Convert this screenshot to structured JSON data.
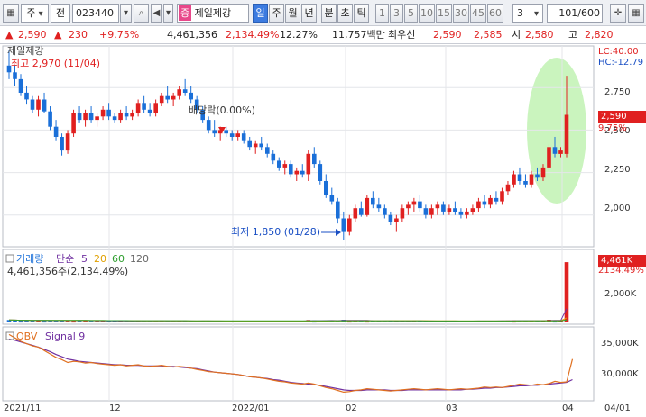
{
  "toolbar": {
    "market_select": "주",
    "type_select": "전",
    "code": "023440",
    "stock_tag": "증",
    "stock_name": "제일제강",
    "periods": [
      "일",
      "주",
      "월",
      "년",
      "분",
      "초",
      "틱"
    ],
    "active_period": "일",
    "intervals": [
      "1",
      "3",
      "5",
      "10",
      "15",
      "30",
      "45",
      "60"
    ],
    "interval_select": "3",
    "page_counter": "101",
    "page_total": "/600"
  },
  "infobar": {
    "price": "2,590",
    "change": "230",
    "change_pct": "+9.75%",
    "volume": "4,461,356",
    "volume_ratio": "2,134.49%",
    "turnover": "12.27%",
    "amount": "11,757백만",
    "best_offer_label": "최우선",
    "best_ask": "2,590",
    "best_bid": "2,585",
    "open_label": "시",
    "open": "2,580",
    "high_label": "고",
    "high": "2,820"
  },
  "price_panel": {
    "title": "제일제강",
    "high_note": "최고 2,970 (11/04)",
    "low_note": "최저 1,850 (01/28)",
    "dividend_note": "배당락(0.00%)",
    "lc_label": "LC:40.00",
    "hc_label": "HC:-12.79",
    "axis": [
      "2,750",
      "2,500",
      "2,250",
      "2,000"
    ],
    "current_price": "2,590",
    "current_change": "9.75%"
  },
  "volume_panel": {
    "legend_title": "거래량",
    "ma_label": "단순",
    "ma_periods": [
      "5",
      "20",
      "60",
      "120"
    ],
    "summary": "4,461,356주(2,134.49%)",
    "axis": [
      "2,000K"
    ],
    "current_volume": "4,461K",
    "current_ratio": "2134.49%"
  },
  "obv_panel": {
    "legend_obv": "OBV",
    "legend_signal": "Signal 9",
    "axis": [
      "35,000K",
      "30,000K"
    ]
  },
  "x_axis": {
    "labels": [
      "2021/11",
      "12",
      "2022/01",
      "02",
      "03",
      "04",
      "04/01"
    ]
  },
  "colors": {
    "up": "#e02020",
    "down": "#1a6fd8",
    "ma5": "#e0a000",
    "ma20": "#2e9e2e",
    "ma60": "#1a4fc4",
    "obv": "#e07020",
    "signal": "#7030a0",
    "highlight": "#b8f0a8"
  },
  "chart_data": {
    "type": "candlestick",
    "price_ylim": [
      1850,
      2900
    ],
    "candles": [
      [
        2880,
        2970,
        2800,
        2840
      ],
      [
        2840,
        2880,
        2760,
        2800
      ],
      [
        2800,
        2830,
        2700,
        2720
      ],
      [
        2720,
        2760,
        2650,
        2680
      ],
      [
        2680,
        2700,
        2600,
        2620
      ],
      [
        2620,
        2700,
        2580,
        2680
      ],
      [
        2680,
        2720,
        2600,
        2610
      ],
      [
        2610,
        2640,
        2500,
        2520
      ],
      [
        2520,
        2560,
        2440,
        2460
      ],
      [
        2460,
        2480,
        2350,
        2380
      ],
      [
        2380,
        2500,
        2360,
        2480
      ],
      [
        2480,
        2620,
        2460,
        2600
      ],
      [
        2600,
        2640,
        2540,
        2560
      ],
      [
        2560,
        2620,
        2520,
        2600
      ],
      [
        2600,
        2640,
        2540,
        2560
      ],
      [
        2560,
        2600,
        2520,
        2580
      ],
      [
        2580,
        2640,
        2560,
        2620
      ],
      [
        2620,
        2660,
        2560,
        2580
      ],
      [
        2580,
        2600,
        2540,
        2560
      ],
      [
        2560,
        2620,
        2540,
        2600
      ],
      [
        2600,
        2640,
        2560,
        2580
      ],
      [
        2580,
        2620,
        2560,
        2600
      ],
      [
        2600,
        2680,
        2580,
        2660
      ],
      [
        2660,
        2700,
        2600,
        2620
      ],
      [
        2620,
        2660,
        2580,
        2600
      ],
      [
        2600,
        2680,
        2580,
        2660
      ],
      [
        2660,
        2720,
        2640,
        2700
      ],
      [
        2700,
        2760,
        2660,
        2680
      ],
      [
        2680,
        2720,
        2640,
        2700
      ],
      [
        2700,
        2760,
        2680,
        2740
      ],
      [
        2740,
        2800,
        2700,
        2720
      ],
      [
        2720,
        2760,
        2660,
        2680
      ],
      [
        2680,
        2700,
        2600,
        2620
      ],
      [
        2620,
        2640,
        2540,
        2560
      ],
      [
        2560,
        2580,
        2480,
        2500
      ],
      [
        2500,
        2560,
        2460,
        2480
      ],
      [
        2480,
        2520,
        2440,
        2500
      ],
      [
        2500,
        2520,
        2460,
        2480
      ],
      [
        2480,
        2500,
        2440,
        2460
      ],
      [
        2460,
        2500,
        2440,
        2480
      ],
      [
        2480,
        2500,
        2420,
        2440
      ],
      [
        2440,
        2460,
        2380,
        2400
      ],
      [
        2400,
        2440,
        2360,
        2420
      ],
      [
        2420,
        2460,
        2380,
        2400
      ],
      [
        2400,
        2420,
        2340,
        2360
      ],
      [
        2360,
        2380,
        2300,
        2320
      ],
      [
        2320,
        2340,
        2260,
        2280
      ],
      [
        2280,
        2320,
        2240,
        2300
      ],
      [
        2300,
        2320,
        2220,
        2240
      ],
      [
        2240,
        2280,
        2200,
        2260
      ],
      [
        2260,
        2300,
        2220,
        2240
      ],
      [
        2240,
        2380,
        2200,
        2360
      ],
      [
        2360,
        2400,
        2280,
        2300
      ],
      [
        2300,
        2320,
        2180,
        2200
      ],
      [
        2200,
        2240,
        2100,
        2120
      ],
      [
        2120,
        2160,
        2060,
        2080
      ],
      [
        2080,
        2100,
        1950,
        1980
      ],
      [
        1980,
        2020,
        1850,
        1900
      ],
      [
        1900,
        2000,
        1880,
        1980
      ],
      [
        1980,
        2060,
        1960,
        2040
      ],
      [
        2040,
        2080,
        1990,
        2000
      ],
      [
        2000,
        2120,
        1990,
        2100
      ],
      [
        2100,
        2140,
        2040,
        2060
      ],
      [
        2060,
        2100,
        2020,
        2040
      ],
      [
        2040,
        2060,
        1980,
        2000
      ],
      [
        2000,
        2020,
        1940,
        1960
      ],
      [
        1960,
        2000,
        1900,
        1980
      ],
      [
        1980,
        2060,
        1960,
        2040
      ],
      [
        2040,
        2080,
        2000,
        2060
      ],
      [
        2060,
        2100,
        2020,
        2080
      ],
      [
        2080,
        2120,
        2020,
        2040
      ],
      [
        2040,
        2060,
        1980,
        2000
      ],
      [
        2000,
        2060,
        1980,
        2040
      ],
      [
        2040,
        2080,
        2000,
        2060
      ],
      [
        2060,
        2080,
        2000,
        2020
      ],
      [
        2020,
        2060,
        2000,
        2040
      ],
      [
        2040,
        2080,
        2000,
        2020
      ],
      [
        2020,
        2040,
        1980,
        2000
      ],
      [
        2000,
        2040,
        1980,
        2020
      ],
      [
        2020,
        2060,
        2000,
        2040
      ],
      [
        2040,
        2100,
        2020,
        2080
      ],
      [
        2080,
        2120,
        2040,
        2060
      ],
      [
        2060,
        2120,
        2040,
        2100
      ],
      [
        2100,
        2140,
        2060,
        2080
      ],
      [
        2080,
        2160,
        2060,
        2140
      ],
      [
        2140,
        2200,
        2120,
        2180
      ],
      [
        2180,
        2260,
        2160,
        2240
      ],
      [
        2240,
        2280,
        2180,
        2200
      ],
      [
        2200,
        2240,
        2160,
        2180
      ],
      [
        2180,
        2260,
        2160,
        2240
      ],
      [
        2240,
        2280,
        2200,
        2220
      ],
      [
        2220,
        2300,
        2200,
        2280
      ],
      [
        2280,
        2420,
        2260,
        2400
      ],
      [
        2400,
        2460,
        2340,
        2360
      ],
      [
        2360,
        2400,
        2340,
        2380
      ],
      [
        2360,
        2820,
        2340,
        2590
      ]
    ],
    "volumes": [
      180,
      160,
      150,
      140,
      130,
      170,
      150,
      120,
      110,
      140,
      160,
      150,
      130,
      120,
      110,
      100,
      120,
      110,
      100,
      110,
      100,
      90,
      120,
      110,
      100,
      110,
      120,
      100,
      90,
      110,
      120,
      100,
      90,
      100,
      110,
      100,
      90,
      80,
      90,
      100,
      90,
      80,
      90,
      100,
      90,
      80,
      90,
      100,
      110,
      90,
      100,
      180,
      150,
      120,
      110,
      130,
      160,
      200,
      150,
      120,
      110,
      150,
      120,
      100,
      90,
      100,
      110,
      130,
      120,
      110,
      100,
      90,
      100,
      110,
      100,
      90,
      100,
      90,
      100,
      110,
      120,
      100,
      110,
      100,
      130,
      140,
      150,
      120,
      110,
      130,
      120,
      140,
      200,
      150,
      130,
      4461
    ],
    "obv": [
      37800,
      37200,
      36600,
      36200,
      35800,
      35600,
      35000,
      34400,
      33800,
      33400,
      32900,
      33100,
      33000,
      32800,
      32900,
      32700,
      32600,
      32500,
      32400,
      32500,
      32300,
      32400,
      32500,
      32300,
      32200,
      32300,
      32400,
      32200,
      32100,
      32200,
      32100,
      31900,
      31700,
      31500,
      31300,
      31200,
      31100,
      31000,
      30900,
      30800,
      30600,
      30400,
      30300,
      30200,
      30000,
      29800,
      29600,
      29500,
      29300,
      29200,
      29100,
      29300,
      29100,
      28800,
      28500,
      28300,
      28000,
      27700,
      27800,
      28000,
      28100,
      28300,
      28200,
      28100,
      28000,
      27900,
      28000,
      28100,
      28200,
      28300,
      28200,
      28100,
      28200,
      28300,
      28200,
      28100,
      28200,
      28300,
      28200,
      28300,
      28400,
      28600,
      28500,
      28600,
      28500,
      28700,
      28900,
      29100,
      29000,
      28900,
      29100,
      29000,
      29200,
      29600,
      29400,
      29500,
      33500
    ],
    "signal": [
      37000,
      36800,
      36500,
      36200,
      35900,
      35600,
      35200,
      34800,
      34300,
      33900,
      33500,
      33300,
      33100,
      33000,
      32900,
      32800,
      32700,
      32600,
      32500,
      32500,
      32400,
      32400,
      32400,
      32300,
      32300,
      32300,
      32300,
      32200,
      32200,
      32100,
      32000,
      31900,
      31800,
      31600,
      31400,
      31200,
      31100,
      31000,
      30900,
      30800,
      30600,
      30400,
      30300,
      30200,
      30100,
      29900,
      29800,
      29600,
      29400,
      29300,
      29200,
      29100,
      29000,
      28900,
      28700,
      28500,
      28300,
      28100,
      28000,
      28000,
      28000,
      28100,
      28100,
      28100,
      28100,
      28000,
      28000,
      28000,
      28100,
      28100,
      28100,
      28100,
      28100,
      28100,
      28100,
      28100,
      28100,
      28100,
      28200,
      28200,
      28300,
      28400,
      28400,
      28500,
      28500,
      28600,
      28700,
      28800,
      28800,
      28900,
      28900,
      29000,
      29100,
      29200,
      29300,
      29400,
      29900
    ]
  }
}
